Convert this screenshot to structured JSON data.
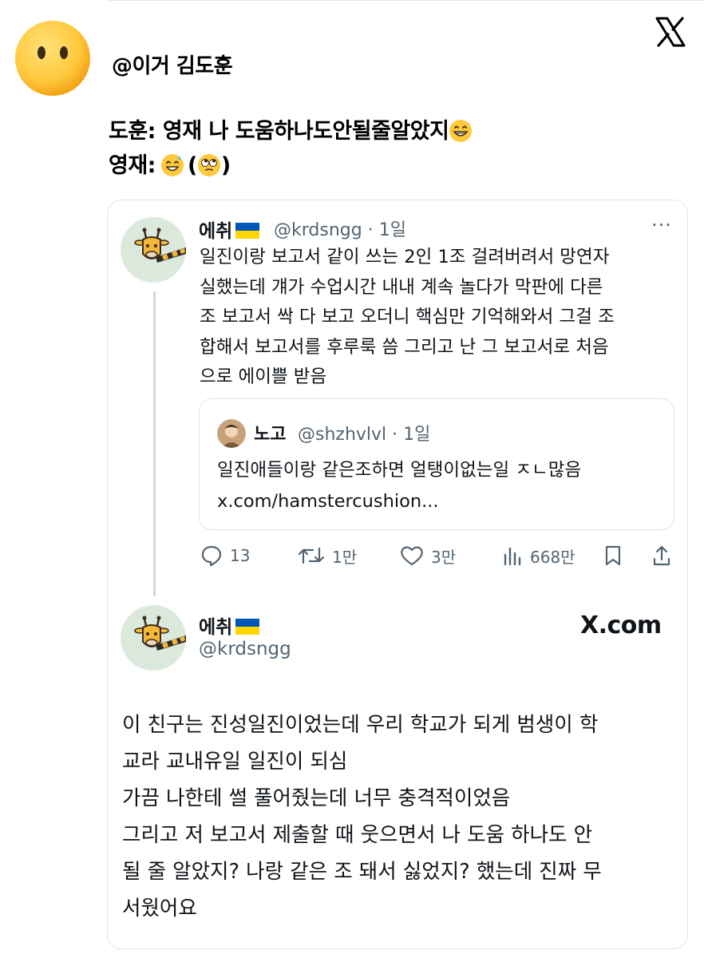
{
  "header": {
    "handle": "@이거 김도훈",
    "message_lines": [
      {
        "text": "도훈: 영재 나 도움하나도안될줄알았지",
        "emojis": [
          "grin-emoji"
        ]
      },
      {
        "text": "영재:",
        "emojis": [
          "sweat-smile-emoji",
          "eye-roll-emoji"
        ]
      }
    ],
    "paren_open": "(",
    "paren_close": ")"
  },
  "tweet": {
    "name": "에취",
    "handle": "@krdsngg",
    "sep": "·",
    "time": "1일",
    "more": "···",
    "lines": [
      "일진이랑 보고서 같이 쓰는 2인 1조 걸려버려서 망연자",
      "실했는데 걔가 수업시간 내내 계속 놀다가 막판에 다른",
      "조 보고서 싹 다 보고 오더니 핵심만 기억해와서 그걸 조",
      "합해서 보고서를 후루룩 씀 그리고 난 그 보고서로 처음",
      "으로 에이쁠 받음"
    ],
    "quote": {
      "name": "노고",
      "handle": "@shzhvlvl",
      "sep": "·",
      "time": "1일",
      "line1": "일진애들이랑 같은조하면 얼탱이없는일 ㅈㄴ많음",
      "line2": "x.com/hamstercushion..."
    },
    "actions": {
      "replies": "13",
      "retweets": "1만",
      "likes": "3만",
      "views": "668만"
    }
  },
  "reply": {
    "name": "에취",
    "handle": "@krdsngg",
    "brand": "X.com",
    "lines": [
      "이 친구는 진성일진이었는데 우리 학교가 되게 범생이 학",
      "교라 교내유일 일진이 되심",
      "가끔 나한테 썰 풀어줬는데 너무 충격적이었음",
      "그리고 저 보고서 제출할 때 웃으면서 나 도움 하나도 안",
      "될 줄 알았지? 나랑 같은 조 돼서 싫었지? 했는데 진짜 무",
      "서웠어요"
    ]
  },
  "colors": {
    "text": "#0f1419",
    "muted": "#536471",
    "border": "#dfe3e7",
    "emoji_yellow": "#ffc83d",
    "flag_blue": "#0057b7",
    "flag_yellow": "#ffd700",
    "avatar_bg": "#dbe9dc"
  }
}
